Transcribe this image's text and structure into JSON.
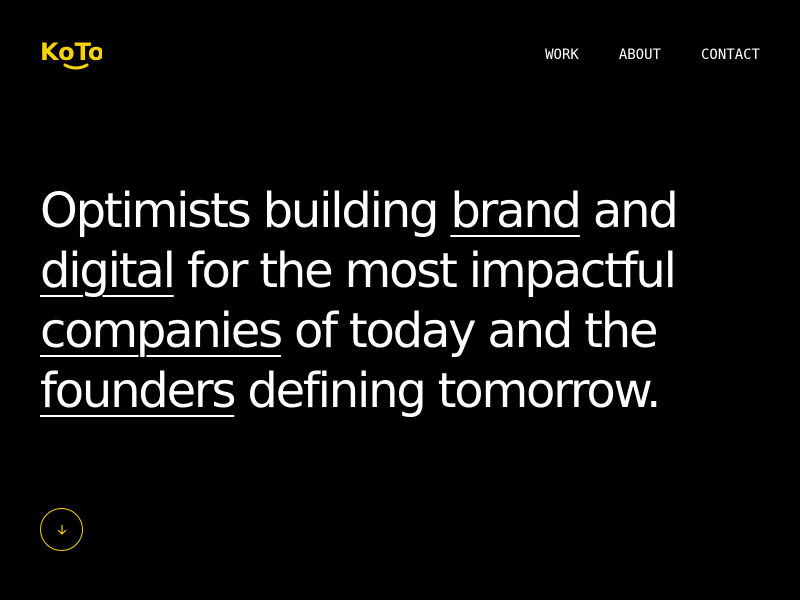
{
  "brand": {
    "name": "KoTo",
    "accent_color": "#f5d20a",
    "background_color": "#000000",
    "text_color": "#ffffff"
  },
  "nav": {
    "items": [
      {
        "label": "WORK"
      },
      {
        "label": "ABOUT"
      },
      {
        "label": "CONTACT"
      }
    ]
  },
  "hero": {
    "lines": [
      [
        {
          "text": "Optimists building ",
          "link": false
        },
        {
          "text": "brand",
          "link": true
        },
        {
          "text": " and",
          "link": false
        }
      ],
      [
        {
          "text": "digital",
          "link": true
        },
        {
          "text": " for the most impactful",
          "link": false
        }
      ],
      [
        {
          "text": "companies",
          "link": true
        },
        {
          "text": " of today and the",
          "link": false
        }
      ],
      [
        {
          "text": "founders",
          "link": true
        },
        {
          "text": " defining tomorrow.",
          "link": false
        }
      ]
    ]
  },
  "scroll_button": {
    "icon": "arrow-down-icon"
  }
}
